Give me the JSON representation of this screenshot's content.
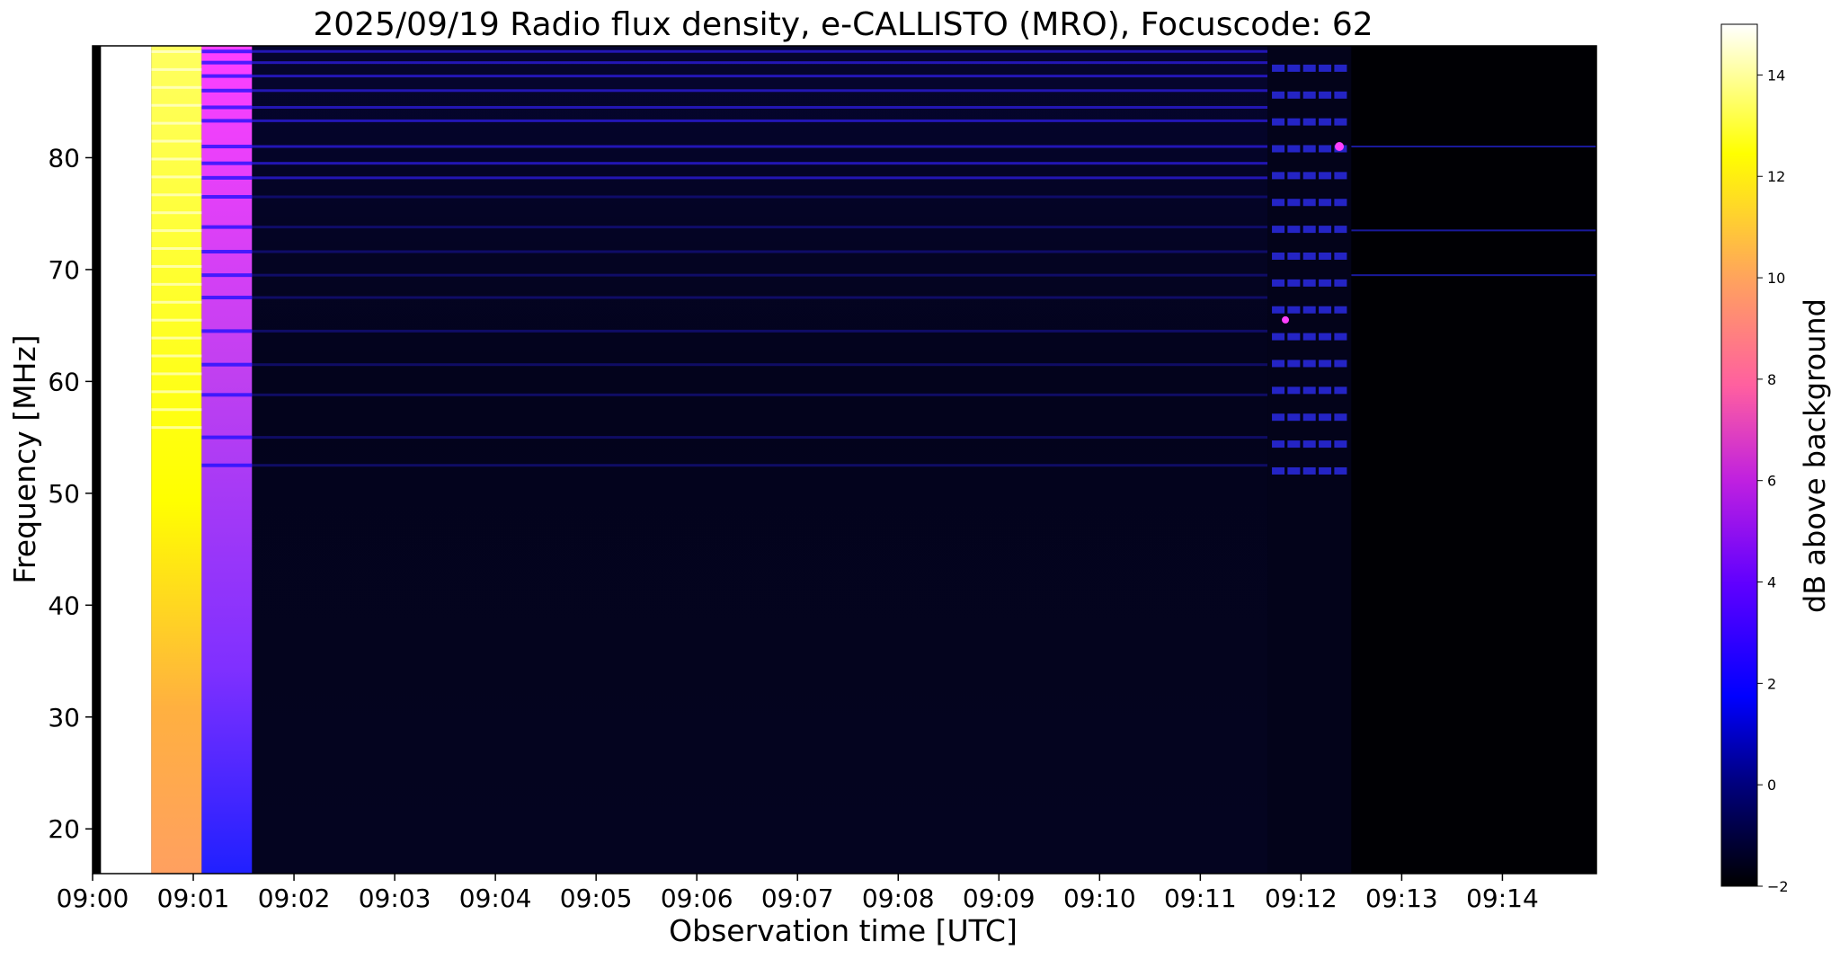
{
  "chart_data": {
    "type": "heatmap",
    "title": "2025/09/19  Radio flux density, e-CALLISTO (MRO), Focuscode: 62",
    "xlabel": "Observation time [UTC]",
    "ylabel": "Frequency [MHz]",
    "x_tick_labels": [
      "09:00",
      "09:01",
      "09:02",
      "09:03",
      "09:04",
      "09:05",
      "09:06",
      "09:07",
      "09:08",
      "09:09",
      "09:10",
      "09:11",
      "09:12",
      "09:13",
      "09:14"
    ],
    "xlim": [
      "09:00:00",
      "09:14:56"
    ],
    "y_ticks": [
      20,
      30,
      40,
      50,
      60,
      70,
      80
    ],
    "ylim": [
      16,
      90
    ],
    "grid": false,
    "colormap": "gnuplot2",
    "colorbar": {
      "label": "dB above background",
      "ticks": [
        -2,
        0,
        2,
        4,
        6,
        8,
        10,
        12,
        14
      ],
      "range": [
        -2,
        15
      ]
    },
    "segments": [
      {
        "t_start": "09:00:00",
        "t_end": "09:00:05",
        "value_db": -2,
        "description": "black"
      },
      {
        "t_start": "09:00:05",
        "t_end": "09:00:35",
        "value_db": 15,
        "description": "saturated"
      },
      {
        "t_start": "09:00:35",
        "t_end": "09:01:05",
        "value_db": 12.5,
        "description": "calibration"
      },
      {
        "t_start": "09:01:05",
        "t_end": "09:01:35",
        "value_db": 6,
        "description": "calibration"
      },
      {
        "t_start": "09:01:35",
        "t_end": "09:11:40",
        "value_db": -0.8,
        "description": "background with RFI lines"
      },
      {
        "t_start": "09:11:40",
        "t_end": "09:12:30",
        "value_db": 0.5,
        "description": "burst-like emission 50-90 MHz"
      },
      {
        "t_start": "09:12:30",
        "t_end": "09:14:56",
        "value_db": -1.8,
        "description": "quiet"
      }
    ],
    "rfi_line_frequencies_mhz": [
      89.5,
      88.5,
      87.3,
      86,
      84.5,
      83.3,
      81,
      79.5,
      78.2,
      76.5,
      73.8,
      71.6,
      69.5,
      67.5,
      64.5,
      61.5,
      58.8,
      55,
      52.5
    ]
  },
  "colors": {
    "cmap_stops": [
      "#000000",
      "#00007f",
      "#0000ff",
      "#5f00ff",
      "#bf20e0",
      "#ff5fa0",
      "#ffa060",
      "#ffff00",
      "#ffffff"
    ]
  }
}
